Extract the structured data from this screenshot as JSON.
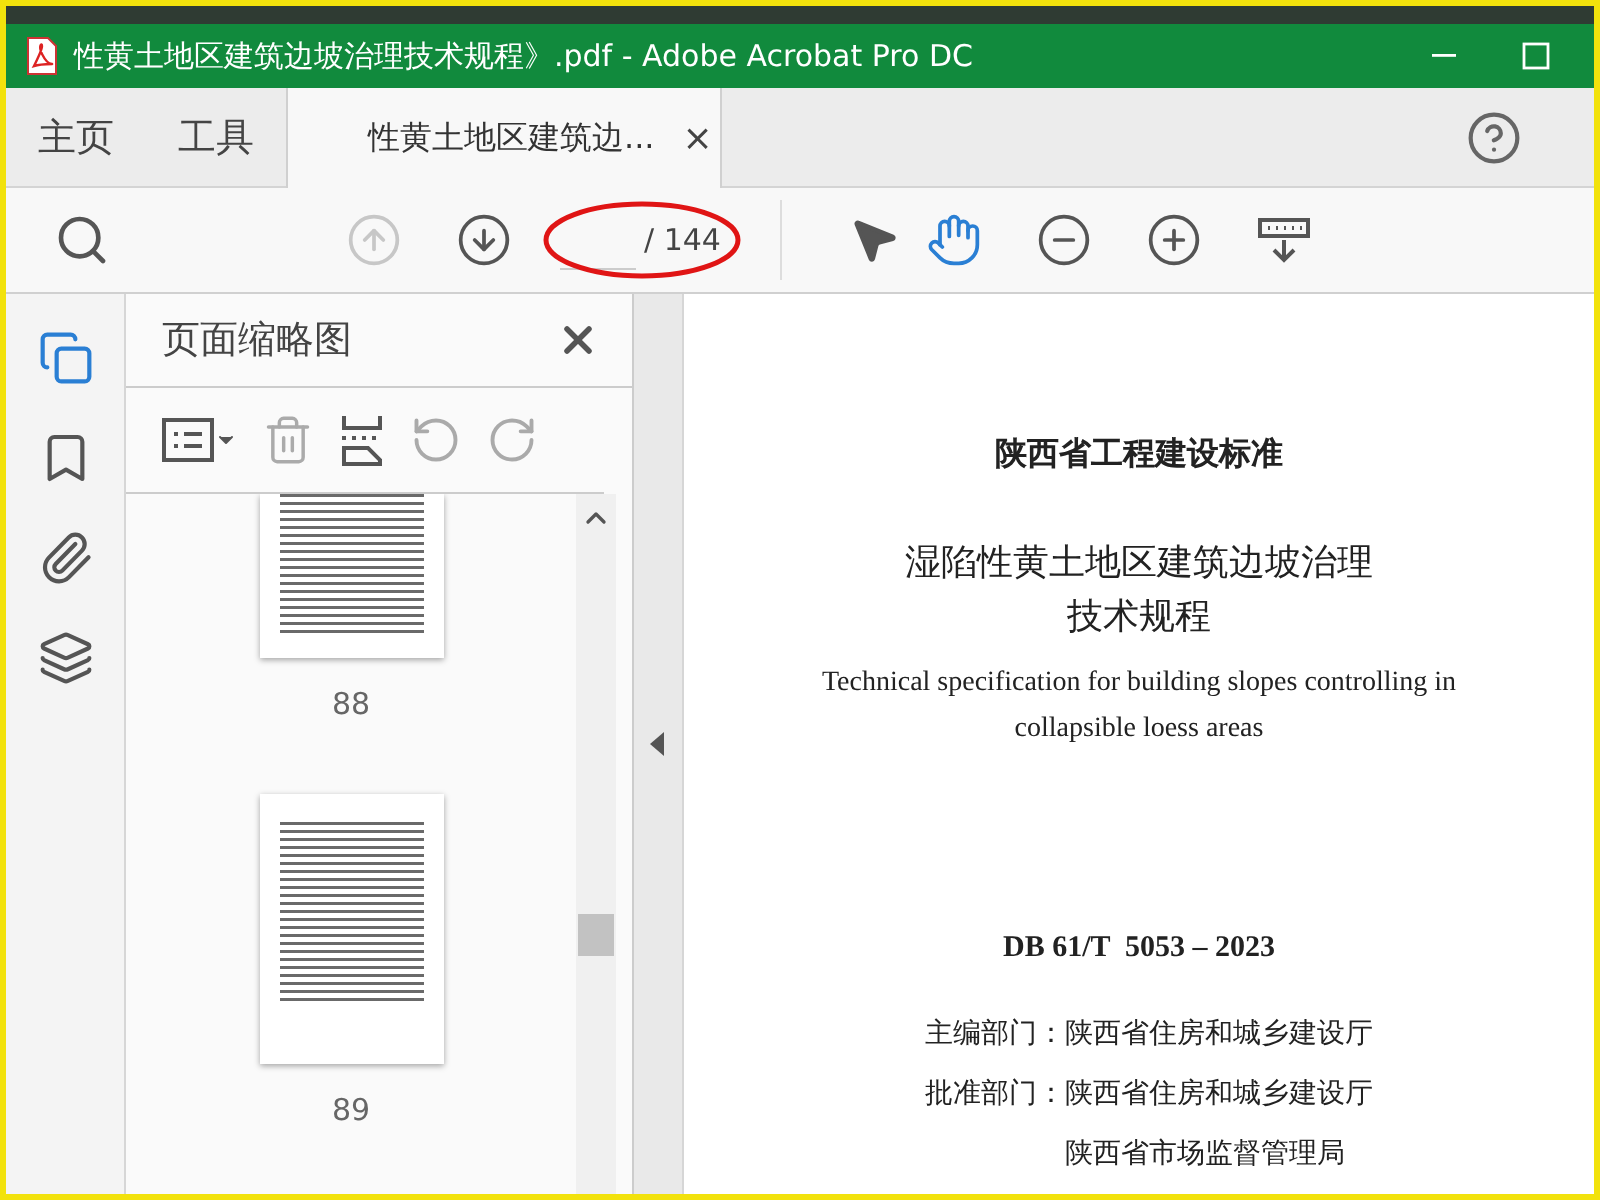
{
  "window": {
    "title": "性黄土地区建筑边坡治理技术规程》.pdf - Adobe Acrobat Pro DC"
  },
  "nav_tabs": [
    {
      "label": "主页",
      "selected": false
    },
    {
      "label": "工具",
      "selected": false
    }
  ],
  "document_tab": {
    "label": "性黄土地区建筑边...",
    "close": "×",
    "selected": true
  },
  "toolbar": {
    "page_total": "/ 144",
    "prev_page": {
      "disabled": true
    },
    "next_page": {
      "disabled": false
    },
    "pointer_tools": [
      {
        "kind": "select",
        "selected": false
      },
      {
        "kind": "hand",
        "selected": true
      }
    ]
  },
  "side_rail": [
    {
      "kind": "pages",
      "selected": true
    },
    {
      "kind": "bookmarks",
      "selected": false
    },
    {
      "kind": "attachments",
      "selected": false
    },
    {
      "kind": "layers",
      "selected": false
    }
  ],
  "thumbnail_panel": {
    "title": "页面缩略图",
    "tools": [
      {
        "kind": "options",
        "disabled": false
      },
      {
        "kind": "delete",
        "disabled": true
      },
      {
        "kind": "insert",
        "disabled": false
      },
      {
        "kind": "rotate_left",
        "disabled": true
      },
      {
        "kind": "rotate_right",
        "disabled": true
      }
    ],
    "thumbnails": [
      {
        "label": "88",
        "selected": false
      },
      {
        "label": "89",
        "selected": false
      }
    ]
  },
  "document": {
    "series": "陕西省工程建设标准",
    "title_lines": [
      "湿陷性黄土地区建筑边坡治理",
      "技术规程"
    ],
    "english_title_lines": [
      "Technical specification for building slopes controlling in",
      "collapsible loess areas"
    ],
    "code": "DB 61/T  5053 – 2023",
    "departments": [
      {
        "label": "主编部门：",
        "names": [
          "陕西省住房和城乡建设厅"
        ]
      },
      {
        "label": "批准部门：",
        "names": [
          "陕西省住房和城乡建设厅",
          "陕西省市场监督管理局"
        ]
      }
    ]
  }
}
